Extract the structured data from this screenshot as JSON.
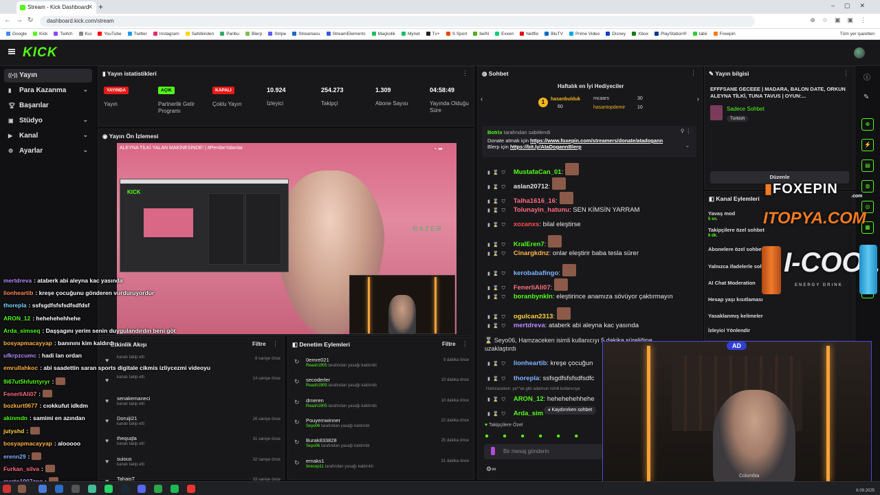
{
  "browser": {
    "tab_title": "Stream - Kick Dashboard",
    "url": "dashboard.kick.com/stream",
    "bookmarks": [
      "Google",
      "Kick",
      "Twitch",
      "Kui",
      "YouTube",
      "Twitter",
      "Instagram",
      "Sahibinden",
      "Paribu",
      "Blerp",
      "Stripe",
      "Streamacu",
      "StreamElements",
      "Maçkolik",
      "Mynet",
      "Tv+",
      "S Sport",
      "beIN",
      "Exxen",
      "Netflix",
      "BluTV",
      "Prime Video",
      "Disney",
      "Xbox",
      "PlayStation®",
      "tabii",
      "Foxepin"
    ],
    "bookmarks_right": "Tüm yer işaretleri"
  },
  "header": {
    "logo": "KICK"
  },
  "sidebar": {
    "items": [
      {
        "label": "Yayın",
        "active": true
      },
      {
        "label": "Para Kazanma",
        "chev": true
      },
      {
        "label": "Başarılar"
      },
      {
        "label": "Stüdyo",
        "chev": true
      },
      {
        "label": "Kanal",
        "chev": true
      },
      {
        "label": "Ayarlar",
        "chev": true
      }
    ]
  },
  "stats": {
    "title": "Yayın istatistikleri",
    "items": [
      {
        "badge": "YAYINDA",
        "badge_color": "#e91916",
        "label": "Yayın"
      },
      {
        "badge": "AÇIK",
        "badge_color": "#53fc18",
        "label": "Partnerlik Gelir Programı"
      },
      {
        "badge": "KAPALI",
        "badge_color": "#e91916",
        "label": "Çoklu Yayın"
      },
      {
        "value": "10.924",
        "label": "İzleyici"
      },
      {
        "value": "254.273",
        "label": "Takipçi"
      },
      {
        "value": "1.309",
        "label": "Abone Sayısı"
      },
      {
        "value": "04:58:49",
        "label": "Yayında Olduğu Süre"
      }
    ]
  },
  "preview": {
    "title": "Yayın Ön İzlemesi",
    "video_title": "ALEYNA TİLKİ YALAN MAKİNESİNDE! | #PembeYalanlar",
    "brand": "RAZER"
  },
  "overlay_chat": [
    {
      "user": "mertdreva",
      "color": "#b58cff",
      "text": ": ataberk abi aleyna kac yasında"
    },
    {
      "user": "lionheartib",
      "color": "#ff8a5c",
      "text": ": kreşe çocuğunu gönderen vurduruyordur"
    },
    {
      "user": "thorepla",
      "color": "#7fd3ff",
      "text": ": ssfsgdfsfsfsdfsdfdsf"
    },
    {
      "user": "ARON_12",
      "color": "#53fc18",
      "text": ": hehehehehhehe"
    },
    {
      "user": "Arda_simseq",
      "color": "#53fc18",
      "text": ": Daşşagını yerim senin duygulandırdın beni göt"
    },
    {
      "user": "bosyapmacayyap",
      "color": "#ffb347",
      "text": ": banınını kim kaldırdı"
    },
    {
      "user": "ufkrpzcumc",
      "color": "#b58cff",
      "text": ": hadi lan ordan"
    },
    {
      "user": "emrullahkoc",
      "color": "#ffb347",
      "text": ": abi saadettin saran sports digitale cikmis izliycezmi videoyu"
    },
    {
      "user": "9i67ut5hfutrtyryr",
      "color": "#53fc18",
      "text": ":",
      "emo": true
    },
    {
      "user": "FenerliAli07",
      "color": "#ff6b81",
      "text": ":",
      "emo": true
    },
    {
      "user": "bozkurt0677",
      "color": "#ffb347",
      "text": ": cıokkufut idkdm"
    },
    {
      "user": "akinmdn",
      "color": "#53fc18",
      "text": ": samimi en azından"
    },
    {
      "user": "jutyshd",
      "color": "#ffd23f",
      "text": ":",
      "emo": true
    },
    {
      "user": "bosyapmacayyap",
      "color": "#ffb347",
      "text": ": alooooo"
    },
    {
      "user": "erenn29",
      "color": "#7fb3ff",
      "text": ":",
      "emo": true
    },
    {
      "user": "Furkan_silva",
      "color": "#ff6b81",
      "text": ":",
      "emo": true
    },
    {
      "user": "merto1907zng",
      "color": "#b58cff",
      "text": ":",
      "emo": true
    }
  ],
  "events": {
    "title": "Etkinlik Akışı",
    "filter": "Filtre",
    "rows": [
      {
        "name": "",
        "sub": "kanalı takip etti",
        "time": "8 saniye önce"
      },
      {
        "name": "",
        "sub": "kanalı takip etti",
        "time": "14 saniye önce"
      },
      {
        "name": "senakemaneci",
        "sub": "kanalı takip etti",
        "time": ""
      },
      {
        "name": "Doruiji21",
        "sub": "kanalı takip etti",
        "time": "26 saniye önce"
      },
      {
        "name": "thequqla",
        "sub": "kanalı takip etti",
        "time": "31 saniye önce"
      },
      {
        "name": "suious",
        "sub": "kanalı takip etti",
        "time": "32 saniye önce"
      },
      {
        "name": "TahaisT",
        "sub": "kanalı takip etti",
        "time": "33 saniye önce"
      }
    ]
  },
  "mod": {
    "title": "Denetim Eylemleri",
    "filter": "Filtre",
    "rows": [
      {
        "name": "0emre021",
        "by": "Reash1905",
        "sub": " tarafından yasağı kaldırıldı",
        "time": "9 dakika önce"
      },
      {
        "name": "secoderler",
        "by": "Reash1905",
        "sub": " tarafından yasağı kaldırıldı",
        "time": "10 dakika önce"
      },
      {
        "name": "drneren",
        "by": "Reash1905",
        "sub": " tarafından yasağı kaldırıldı",
        "time": "10 dakika önce"
      },
      {
        "name": "Pouyernwinner",
        "by": "Seyo06",
        "sub": " tarafından yasağı kaldırıldı",
        "time": "22 dakika önce"
      },
      {
        "name": "Burak833828",
        "by": "Seyo06",
        "sub": " tarafından yasağı kaldırıldı",
        "time": "25 dakika önce"
      },
      {
        "name": "ernaks1",
        "by": "Ikrecep11",
        "sub": " tarafından yasağı kaldırıldı",
        "time": "31 dakika önce"
      }
    ]
  },
  "chat": {
    "title": "Sohbet",
    "gifters_title": "Haftalık en İyi Hediyeciler",
    "gifters": [
      {
        "name": "hasanbulduk",
        "value": "60",
        "rank": "1"
      },
      {
        "name": "mcaars",
        "value": "30"
      },
      {
        "name": "hasantopdemir",
        "value": "10"
      }
    ],
    "pinned_by": "Botrix",
    "pinned_by_suffix": " tarafından sabitlendi",
    "pinned_line1_prefix": "Donate atmak için ",
    "pinned_link1": "https://www.foxepin.com/streamers/donate/atadogann",
    "pinned_line2_prefix": "Blerp için ",
    "pinned_link2": "https://bit.ly/AtaDogannBlerp",
    "messages": [
      {
        "user": "MustafaCan_01",
        "color": "#53fc18",
        "text": ":",
        "emo": true
      },
      {
        "user": "aslan20712",
        "color": "#e6e6e6",
        "text": ":",
        "emo": true
      },
      {
        "user": "Talha1616_16",
        "color": "#ff6b81",
        "text": ":",
        "emo": true
      },
      {
        "user": "Tolunayin_hatunu",
        "color": "#ff6b81",
        "text": ": SEN KİMSİN YARRAM"
      },
      {
        "user": "xozanxs",
        "color": "#ff4d4d",
        "text": ": bilal eleştirse"
      },
      {
        "user": "KralEren7",
        "color": "#53fc18",
        "text": ":",
        "emo": true
      },
      {
        "user": "Cinargkdnz",
        "color": "#ffb347",
        "text": ": onlar eleştirir baba tesla sürer"
      },
      {
        "user": "kerobabafingo",
        "color": "#7fb3ff",
        "text": ":",
        "emo": true
      },
      {
        "user": "FenerliAli07",
        "color": "#ff6b81",
        "text": ":",
        "emo": true
      },
      {
        "user": "boranbynkln",
        "color": "#53fc18",
        "text": ": eleştirince anamıza sövüyor çaktırmayın"
      },
      {
        "user": "ogulcan2313",
        "color": "#ffd23f",
        "text": ":",
        "emo": true
      },
      {
        "user": "mertdreva",
        "color": "#b58cff",
        "text": ": ataberk abi aleyna kac yasında"
      }
    ],
    "system_msg": "Seyo06, Hamzaceken isimli kullanıcıyı 5 dakika süreliğine uzaklaştırdı",
    "messages2": [
      {
        "user": "lionheartib",
        "color": "#7fb3ff",
        "text": ": kreşe çocuğun"
      },
      {
        "user": "thorepla",
        "color": "#7fb3ff",
        "text": ": ssfsgdfsfsfsdfsdfc"
      }
    ],
    "deleted_note": "Hamzaceken: ya**ak gibi adamsın isimli kullanıcıya",
    "messages3": [
      {
        "user": "ARON_12",
        "color": "#53fc18",
        "text": ": hehehehehhehe"
      },
      {
        "user": "Arda_sim",
        "color": "#53fc18",
        "text": ""
      }
    ],
    "paused": "Kaydırırken sohbet",
    "followers_only": "Takipçilere Özel",
    "input_placeholder": "Bir mesaj gönderin"
  },
  "info": {
    "title": "Yayın bilgisi",
    "stream_title": "EFFFSANE GECEEE | MADARA, BALON DATE, ORKUN ALEYNA TİLKİ, TUNA TAVUS | OYUN:...",
    "category": "Sadece Sohbet",
    "language": "Turkish",
    "edit": "Düzenle"
  },
  "channel_actions": {
    "title": "Kanal Eylemleri",
    "items": [
      {
        "label": "Yavaş mod",
        "sub": "5 sn."
      },
      {
        "label": "Takipçilere özel sohbet",
        "sub": "6 dk."
      },
      {
        "label": "Abonelere özel sohbet",
        "sub": ""
      },
      {
        "label": "Yalnızca ifadelerle sohbet",
        "sub": ""
      },
      {
        "label": "AI Chat Moderation",
        "sub": ""
      },
      {
        "label": "Hesap yaşı kısıtlaması",
        "sub": ""
      },
      {
        "label": "Yasaklanmış kelimeler",
        "sub": ""
      },
      {
        "label": "İzleyici Yönlendir",
        "sub": ""
      }
    ]
  },
  "sponsors": {
    "foxepin": "FOXEPIN",
    "foxepin_domain": ".com",
    "itopya": "ITOPYA.COM",
    "icool": "I-COOL",
    "icool_sub": "ENERGY DRINK",
    "webcam_badge": "AD",
    "shirt": "Columbia"
  },
  "taskbar": {
    "time": "",
    "date": "6.09.2025"
  }
}
